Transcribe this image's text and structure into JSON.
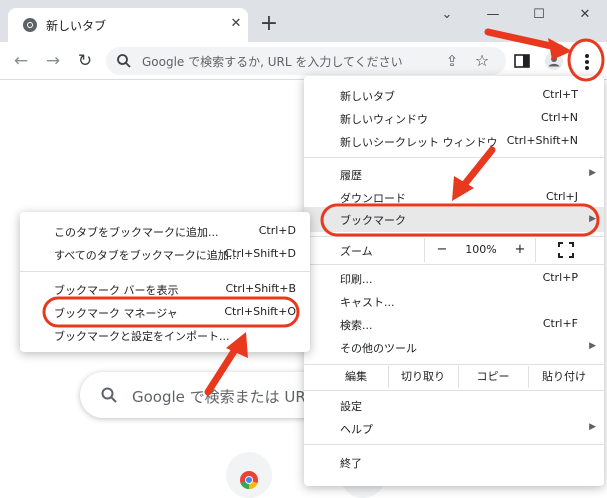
{
  "tab": {
    "title": "新しいタブ",
    "close": "✕",
    "favicon": "chrome-icon"
  },
  "window_controls": {
    "minimize": "—",
    "maximize": "☐",
    "close": "✕",
    "dropdown": "⌄"
  },
  "toolbar": {
    "back": "←",
    "forward": "→",
    "reload": "↻",
    "omnibox_placeholder": "Google で検索するか, URL を入力してください",
    "share": "⇪",
    "bookmark_star": "☆",
    "sidepanel_icon": "side-panel-icon",
    "profile_icon": "profile-icon",
    "menu_icon": "kebab-menu-icon"
  },
  "main_menu": {
    "items_top": [
      {
        "label": "新しいタブ",
        "shortcut": "Ctrl+T"
      },
      {
        "label": "新しいウィンドウ",
        "shortcut": "Ctrl+N"
      },
      {
        "label": "新しいシークレット ウィンドウ",
        "shortcut": "Ctrl+Shift+N"
      }
    ],
    "items_mid": [
      {
        "label": "履歴",
        "shortcut": ""
      },
      {
        "label": "ダウンロード",
        "shortcut": "Ctrl+J"
      },
      {
        "label": "ブックマーク",
        "shortcut": ""
      }
    ],
    "zoom": {
      "label": "ズーム",
      "minus": "−",
      "value": "100%",
      "plus": "+"
    },
    "items_tools": [
      {
        "label": "印刷...",
        "shortcut": "Ctrl+P"
      },
      {
        "label": "キャスト...",
        "shortcut": ""
      },
      {
        "label": "検索...",
        "shortcut": "Ctrl+F"
      },
      {
        "label": "その他のツール",
        "shortcut": ""
      }
    ],
    "edit": {
      "label": "編集",
      "cut": "切り取り",
      "copy": "コピー",
      "paste": "貼り付け"
    },
    "items_bottom": [
      {
        "label": "設定",
        "shortcut": ""
      },
      {
        "label": "ヘルプ",
        "shortcut": ""
      }
    ],
    "exit": {
      "label": "終了"
    }
  },
  "bookmark_submenu": {
    "items": [
      {
        "label": "このタブをブックマークに追加...",
        "shortcut": "Ctrl+D"
      },
      {
        "label": "すべてのタブをブックマークに追加...",
        "shortcut": "Ctrl+Shift+D"
      },
      {
        "label": "ブックマーク バーを表示",
        "shortcut": "Ctrl+Shift+B"
      },
      {
        "label": "ブックマーク マネージャ",
        "shortcut": "Ctrl+Shift+O"
      },
      {
        "label": "ブックマークと設定をインポート...",
        "shortcut": ""
      }
    ]
  },
  "ntp": {
    "search_placeholder": "Google で検索または URL"
  },
  "colors": {
    "annotation": "#e8391e",
    "highlight": "#e8e8e9",
    "tabstrip": "#dee1e6"
  }
}
